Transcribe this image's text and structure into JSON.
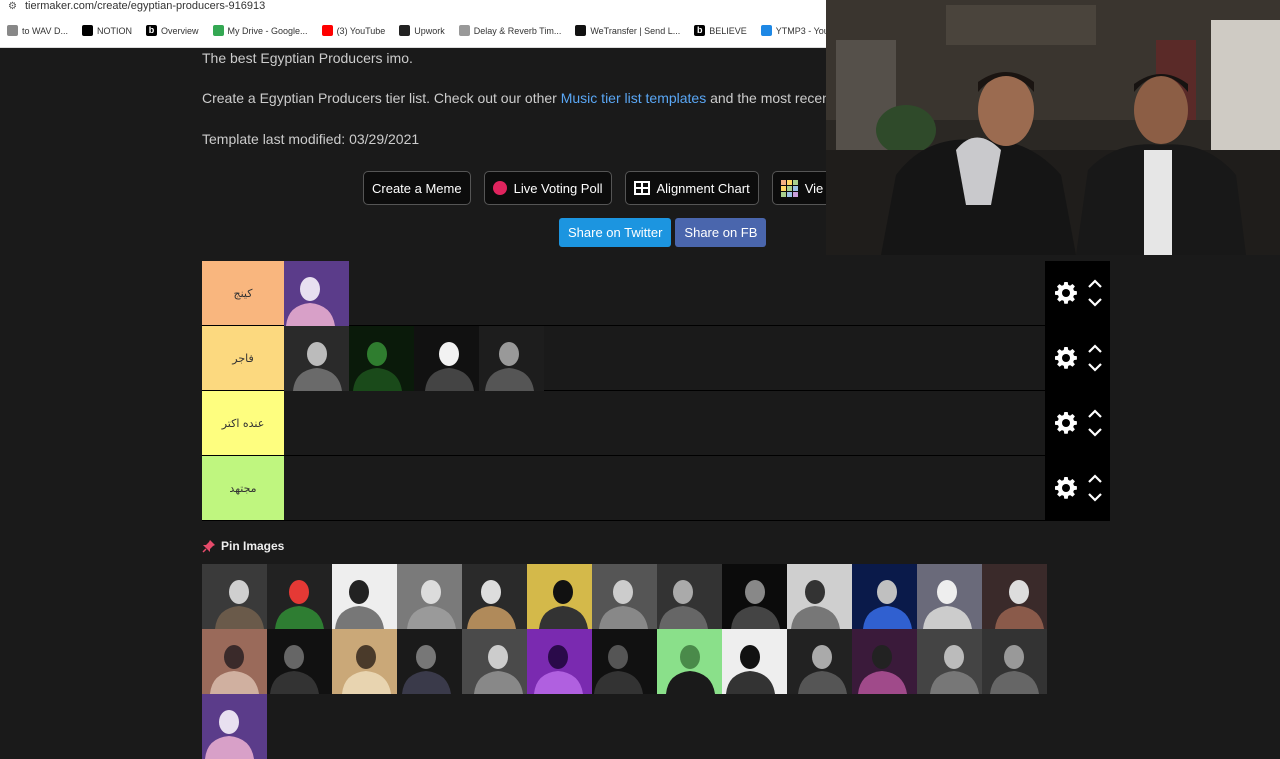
{
  "browser": {
    "url": "tiermaker.com/create/egyptian-producers-916913",
    "bookmarks": [
      {
        "icon": "doc-icon",
        "label": "to WAV D...",
        "color": "#888888"
      },
      {
        "icon": "notion-icon",
        "label": "NOTION",
        "color": "#000000"
      },
      {
        "icon": "b-icon",
        "label": "Overview",
        "color": "#000000"
      },
      {
        "icon": "drive-icon",
        "label": "My Drive - Google...",
        "color": "#34a853"
      },
      {
        "icon": "youtube-icon",
        "label": "(3) YouTube",
        "color": "#ff0000"
      },
      {
        "icon": "upwork-icon",
        "label": "Upwork",
        "color": "#222222"
      },
      {
        "icon": "delay-icon",
        "label": "Delay & Reverb Tim...",
        "color": "#999999"
      },
      {
        "icon": "wetransfer-icon",
        "label": "WeTransfer | Send L...",
        "color": "#111111"
      },
      {
        "icon": "b-icon",
        "label": "BELIEVE",
        "color": "#000000"
      },
      {
        "icon": "ytmp3-icon",
        "label": "YTMP3 - YouTube t...",
        "color": "#1e88e5"
      }
    ]
  },
  "page": {
    "description": "The best Egyptian Producers imo.",
    "intro_prefix": "Create a Egyptian Producers tier list. Check out our other ",
    "intro_link": "Music tier list templates",
    "intro_suffix": " and the most recent",
    "modified": "Template last modified: 03/29/2021"
  },
  "actions": {
    "meme": "Create a Meme",
    "poll": "Live Voting Poll",
    "alignment": "Alignment Chart",
    "view": "Vie"
  },
  "share": {
    "twitter": "Share on Twitter",
    "facebook": "Share on FB"
  },
  "tiers": [
    {
      "label": "كينج",
      "color": "#f9b67e",
      "count": 1
    },
    {
      "label": "فاجر",
      "color": "#fcd97f",
      "count": 4
    },
    {
      "label": "عنده اكتر",
      "color": "#fefe7f",
      "count": 0
    },
    {
      "label": "مجتهد",
      "color": "#bff67f",
      "count": 0
    }
  ],
  "pin_label": "Pin Images",
  "pool_count": 27
}
